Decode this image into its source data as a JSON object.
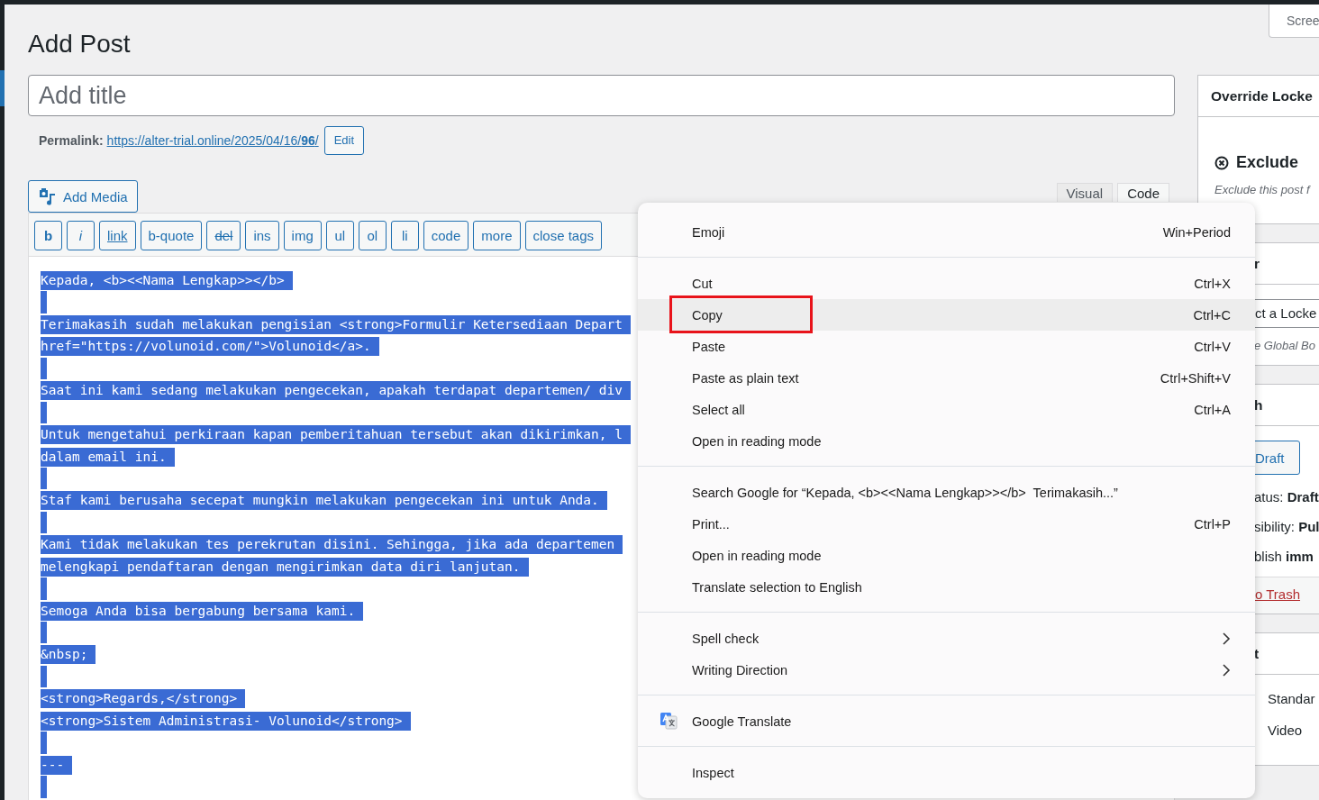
{
  "screen_options": {
    "label": "Scree"
  },
  "page_title": "Add Post",
  "title_field": {
    "placeholder": "Add title"
  },
  "permalink": {
    "label": "Permalink:",
    "url": "https://alter-trial.online/2025/04/16/**96**/",
    "edit_button": "Edit"
  },
  "add_media": {
    "label": "Add Media"
  },
  "editor_tabs": [
    {
      "label": "Visual",
      "selected": false
    },
    {
      "label": "Code",
      "selected": true
    }
  ],
  "quicktags": [
    {
      "label": "b",
      "kind": "bold"
    },
    {
      "label": "i",
      "kind": "italic"
    },
    {
      "label": "link",
      "kind": "underline"
    },
    {
      "label": "b-quote",
      "kind": "plain"
    },
    {
      "label": "del",
      "kind": "strike"
    },
    {
      "label": "ins",
      "kind": "plain"
    },
    {
      "label": "img",
      "kind": "plain"
    },
    {
      "label": "ul",
      "kind": "plain"
    },
    {
      "label": "ol",
      "kind": "plain"
    },
    {
      "label": "li",
      "kind": "plain"
    },
    {
      "label": "code",
      "kind": "plain"
    },
    {
      "label": "more",
      "kind": "plain"
    },
    {
      "label": "close tags",
      "kind": "plain"
    }
  ],
  "editor_lines": [
    {
      "kind": "text",
      "text": "Kepada, <b><<Nama Lengkap>></b>"
    },
    {
      "kind": "blank"
    },
    {
      "kind": "text",
      "text": "Terimakasih sudah melakukan pengisian <strong>Formulir Ketersediaan Depart"
    },
    {
      "kind": "text",
      "text": "href=\"https://volunoid.com/\">Volunoid</a>."
    },
    {
      "kind": "blank"
    },
    {
      "kind": "text",
      "text": "Saat ini kami sedang melakukan pengecekan, apakah terdapat departemen/ div"
    },
    {
      "kind": "blank"
    },
    {
      "kind": "text",
      "text": "Untuk mengetahui perkiraan kapan pemberitahuan tersebut akan dikirimkan, l"
    },
    {
      "kind": "text",
      "text": "dalam email ini."
    },
    {
      "kind": "blank"
    },
    {
      "kind": "text",
      "text": "Staf kami berusaha secepat mungkin melakukan pengecekan ini untuk Anda."
    },
    {
      "kind": "blank"
    },
    {
      "kind": "text",
      "text": "Kami tidak melakukan tes perekrutan disini. Sehingga, jika ada departemen"
    },
    {
      "kind": "text",
      "text": "melengkapi pendaftaran dengan mengirimkan data diri lanjutan."
    },
    {
      "kind": "blank"
    },
    {
      "kind": "text",
      "text": "Semoga Anda bisa bergabung bersama kami."
    },
    {
      "kind": "blank"
    },
    {
      "kind": "text",
      "text": "&nbsp;"
    },
    {
      "kind": "blank"
    },
    {
      "kind": "text",
      "text": "<strong>Regards,</strong>"
    },
    {
      "kind": "text",
      "text": "<strong>Sistem Administrasi- Volunoid</strong>"
    },
    {
      "kind": "blank"
    },
    {
      "kind": "text",
      "text": "---"
    },
    {
      "kind": "blank"
    }
  ],
  "sidebar": [
    {
      "kind": "override",
      "header": "Override Locke",
      "option": "Exclude",
      "hint": "Exclude this post f"
    },
    {
      "kind": "locked",
      "header": "r",
      "field": "ct a Locke",
      "hint": "e Global Bo"
    },
    {
      "kind": "publish",
      "header": "h",
      "draft_button": "Draft",
      "lines": [
        "atus: **Draft**",
        "sibility: **Pul**",
        "blish **imm**"
      ],
      "trash": "o Trash"
    },
    {
      "kind": "format",
      "header": "t",
      "options": [
        "Standar",
        "Video"
      ]
    }
  ],
  "context_menu": [
    [
      {
        "label": "Emoji",
        "shortcut": "Win+Period",
        "selected": false
      }
    ],
    [
      {
        "label": "Cut",
        "shortcut": "Ctrl+X",
        "selected": false
      },
      {
        "label": "Copy",
        "shortcut": "Ctrl+C",
        "selected": true,
        "annotated": true
      },
      {
        "label": "Paste",
        "shortcut": "Ctrl+V",
        "selected": false
      },
      {
        "label": "Paste as plain text",
        "shortcut": "Ctrl+Shift+V",
        "selected": false
      },
      {
        "label": "Select all",
        "shortcut": "Ctrl+A",
        "selected": false
      },
      {
        "label": "Open in reading mode",
        "selected": false
      }
    ],
    [
      {
        "label": "Search Google for “Kepada, <b><<Nama Lengkap>></b>  Terimakasih...”",
        "selected": false
      },
      {
        "label": "Print...",
        "shortcut": "Ctrl+P",
        "selected": false
      },
      {
        "label": "Open in reading mode",
        "selected": false
      },
      {
        "label": "Translate selection to English",
        "selected": false
      }
    ],
    [
      {
        "label": "Spell check",
        "submenu": true,
        "selected": false
      },
      {
        "label": "Writing Direction",
        "submenu": true,
        "selected": false
      }
    ],
    [
      {
        "label": "Google Translate",
        "kind": "translate",
        "selected": false
      }
    ],
    [
      {
        "label": "Inspect",
        "selected": false
      }
    ]
  ]
}
